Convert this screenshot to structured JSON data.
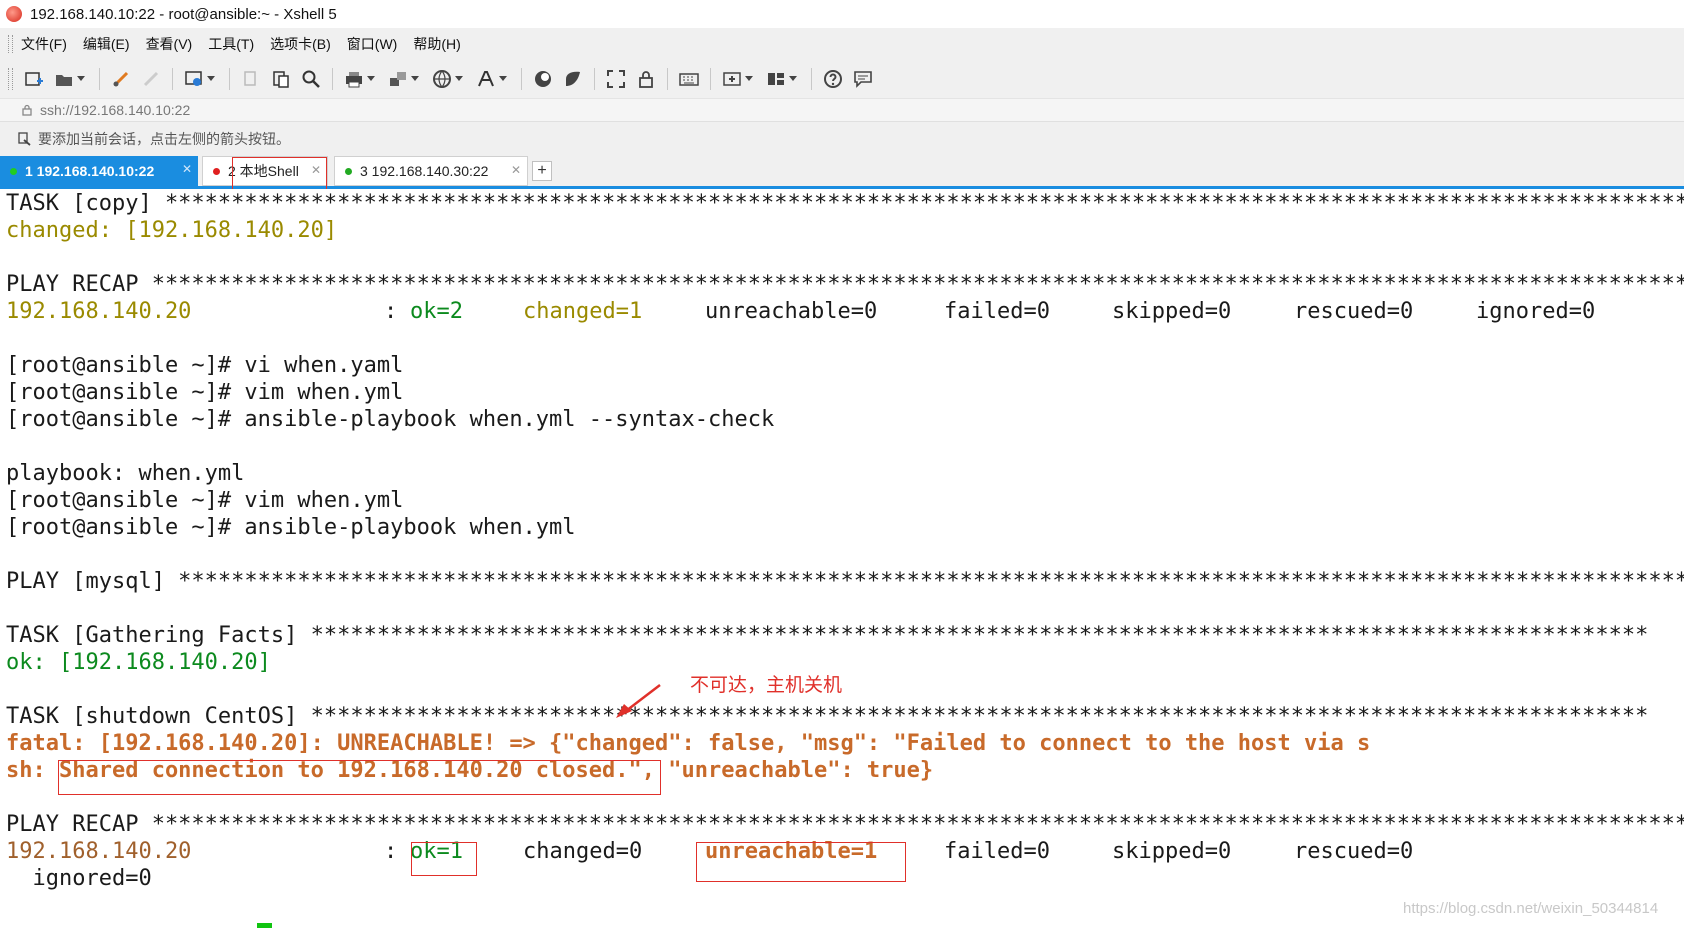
{
  "window": {
    "title": "192.168.140.10:22 - root@ansible:~ - Xshell 5"
  },
  "menu": [
    "文件(F)",
    "编辑(E)",
    "查看(V)",
    "工具(T)",
    "选项卡(B)",
    "窗口(W)",
    "帮助(H)"
  ],
  "toolbar_icons": [
    "new-session-icon",
    "open-folder-icon",
    "reconnect-icon",
    "disconnect-icon",
    "properties-icon",
    "copy-icon",
    "paste-icon",
    "find-icon",
    "print-icon",
    "transfer-icon",
    "globe-icon",
    "font-icon",
    "xftp-icon",
    "xmanager-icon",
    "fullscreen-icon",
    "lock-icon",
    "keyboard-icon",
    "new-tab-icon",
    "layout-icon",
    "help-icon",
    "chat-icon"
  ],
  "address": {
    "value": "ssh://192.168.140.10:22"
  },
  "hint": {
    "text": "要添加当前会话，点击左侧的箭头按钮。"
  },
  "tabs": [
    {
      "label": "1 192.168.140.10:22",
      "status_color": "#22cc22",
      "active": true
    },
    {
      "label": "2 本地Shell",
      "status_color": "#e02020",
      "active": false
    },
    {
      "label": "3 192.168.140.30:22",
      "status_color": "#22aa22",
      "active": false
    }
  ],
  "terminal": {
    "lines": [
      {
        "text": "TASK [copy] *******************************************************************************************************************************************************",
        "cls": ""
      },
      {
        "text": "changed: [192.168.140.20]",
        "cls": "c-olive"
      },
      {
        "text": "",
        "cls": ""
      },
      {
        "text": "PLAY RECAP *******************************************************************************************************************************************************",
        "cls": ""
      },
      {
        "text": "192.168.140.20",
        "cls": "recap1"
      },
      {
        "text": "",
        "cls": ""
      },
      {
        "text": "[root@ansible ~]# vi when.yaml",
        "cls": ""
      },
      {
        "text": "[root@ansible ~]# vim when.yml",
        "cls": ""
      },
      {
        "text": "[root@ansible ~]# ansible-playbook when.yml --syntax-check",
        "cls": ""
      },
      {
        "text": "",
        "cls": ""
      },
      {
        "text": "playbook: when.yml",
        "cls": ""
      },
      {
        "text": "[root@ansible ~]# vim when.yml",
        "cls": ""
      },
      {
        "text": "[root@ansible ~]# ansible-playbook when.yml",
        "cls": ""
      },
      {
        "text": "",
        "cls": ""
      },
      {
        "text": "PLAY [mysql] ***************************************************************************************************************************",
        "cls": ""
      },
      {
        "text": "",
        "cls": ""
      },
      {
        "text": "TASK [Gathering Facts] *****************************************************************************************************",
        "cls": ""
      },
      {
        "text": "ok: [192.168.140.20]",
        "cls": "c-green"
      },
      {
        "text": "",
        "cls": ""
      },
      {
        "text": "TASK [shutdown CentOS] *****************************************************************************************************",
        "cls": ""
      },
      {
        "text": "fatal: [192.168.140.20]: UNREACHABLE! => {\"changed\": false, \"msg\": \"Failed to connect to the host via s",
        "cls": "c-orange"
      },
      {
        "text": "sh: Shared connection to 192.168.140.20 closed.\", \"unreachable\": true}",
        "cls": "c-orange"
      },
      {
        "text": "",
        "cls": ""
      },
      {
        "text": "PLAY RECAP *****************************************************************************************************************************",
        "cls": ""
      },
      {
        "text": "192.168.140.20",
        "cls": "recap2"
      },
      {
        "text": "  ignored=0",
        "cls": ""
      }
    ],
    "recap1": {
      "host": "192.168.140.20",
      "ok": "ok=2",
      "changed": "changed=1",
      "unreachable": "unreachable=0",
      "failed": "failed=0",
      "skipped": "skipped=0",
      "rescued": "rescued=0",
      "ignored": "ignored=0"
    },
    "recap2": {
      "host": "192.168.140.20",
      "ok": "ok=1",
      "changed": "changed=0",
      "unreachable": "unreachable=1",
      "failed": "failed=0",
      "skipped": "skipped=0",
      "rescued": "rescued=0"
    }
  },
  "annotation": {
    "text": "不可达，主机关机",
    "color": "#e0302a"
  },
  "watermark": "https://blog.csdn.net/weixin_50344814",
  "colors": {
    "accent": "#1a8de0",
    "green": "#0c8a1e",
    "olive": "#9a8a00",
    "error": "#c86a2a",
    "annotation": "#e0302a"
  }
}
